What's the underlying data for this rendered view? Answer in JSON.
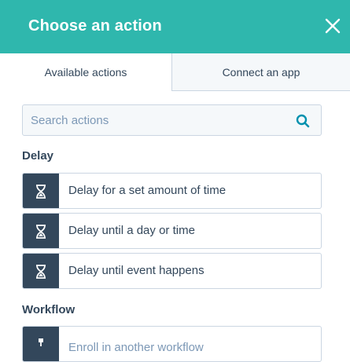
{
  "header": {
    "title": "Choose an action"
  },
  "tabs": [
    {
      "label": "Available actions"
    },
    {
      "label": "Connect an app"
    }
  ],
  "search": {
    "placeholder": "Search actions"
  },
  "sections": [
    {
      "title": "Delay",
      "actions": [
        {
          "label": "Delay for a set amount of time",
          "icon": "hourglass-icon"
        },
        {
          "label": "Delay until a day or time",
          "icon": "hourglass-icon"
        },
        {
          "label": "Delay until event happens",
          "icon": "hourglass-icon"
        }
      ]
    },
    {
      "title": "Workflow",
      "actions": [
        {
          "label": "Enroll in another workflow",
          "icon": "workflow-icon"
        }
      ]
    }
  ],
  "colors": {
    "header": "#2fb7ad",
    "icon_box": "#33475b",
    "border": "#cbd6e2",
    "text": "#33475b"
  }
}
